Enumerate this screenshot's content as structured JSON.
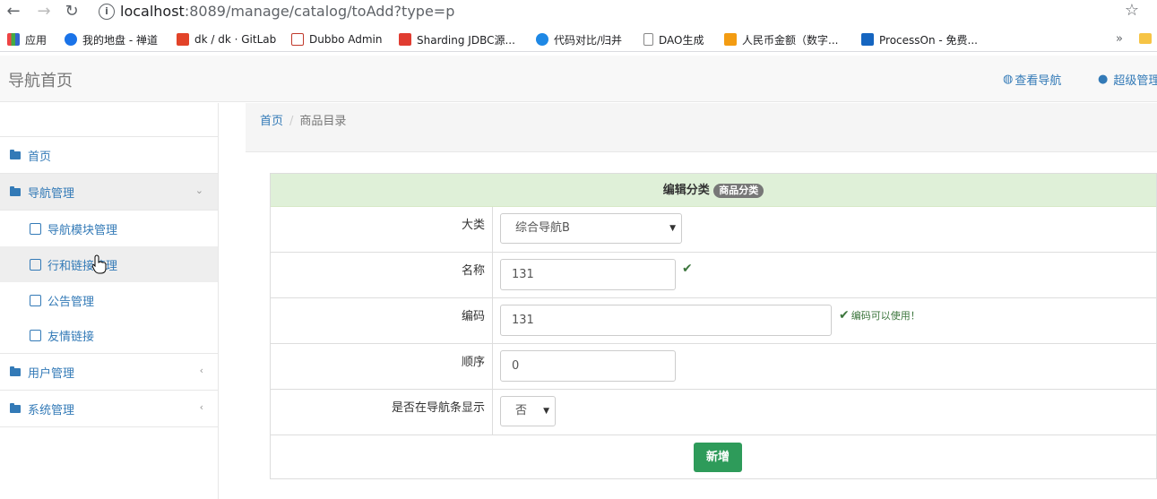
{
  "browser": {
    "url_host": "localhost",
    "url_rest": ":8089/manage/catalog/toAdd?type=p",
    "back_icon": "back-arrow-icon",
    "forward_icon": "forward-arrow-icon",
    "reload_icon": "reload-icon"
  },
  "bookmarks": [
    {
      "label": "应用",
      "icon": "apps-grid-icon",
      "color": "#e44"
    },
    {
      "label": "我的地盘 - 禅道",
      "icon": "zentao-icon",
      "color": "#1a73e8"
    },
    {
      "label": "dk / dk · GitLab",
      "icon": "gitlab-icon",
      "color": "#e24329"
    },
    {
      "label": "Dubbo Admin",
      "icon": "dubbo-icon",
      "color": "#c0392b"
    },
    {
      "label": "Sharding JDBC源...",
      "icon": "sharding-icon",
      "color": "#e03c31"
    },
    {
      "label": "代码对比/归并",
      "icon": "diff-icon",
      "color": "#1e88e5"
    },
    {
      "label": "DAO生成",
      "icon": "doc-icon",
      "color": "#888"
    },
    {
      "label": "人民币金额（数字...",
      "icon": "rmb-icon",
      "color": "#f39c12"
    },
    {
      "label": "ProcessOn - 免费...",
      "icon": "processon-icon",
      "color": "#1565c0"
    }
  ],
  "bookmarks_more": "»",
  "header": {
    "brand": "导航首页",
    "view_nav": "查看导航",
    "admin": "超级管理"
  },
  "sidebar": {
    "items": [
      {
        "label": "首页"
      },
      {
        "label": "导航管理",
        "arrow": "⌄"
      },
      {
        "label": "用户管理",
        "arrow": "‹"
      },
      {
        "label": "系统管理",
        "arrow": "‹"
      }
    ],
    "subitems": [
      {
        "label": "导航模块管理"
      },
      {
        "label": "行和链接管理"
      },
      {
        "label": "公告管理"
      },
      {
        "label": "友情链接"
      }
    ]
  },
  "breadcrumb": {
    "home": "首页",
    "current": "商品目录"
  },
  "form": {
    "title": "编辑分类",
    "badge": "商品分类",
    "fields": {
      "category_label": "大类",
      "category_value": "综合导航B",
      "name_label": "名称",
      "name_value": "131",
      "code_label": "编码",
      "code_value": "131",
      "code_msg": "编码可以使用！",
      "order_label": "顺序",
      "order_value": "0",
      "show_label": "是否在导航条显示",
      "show_value": "否"
    },
    "submit": "新增"
  }
}
